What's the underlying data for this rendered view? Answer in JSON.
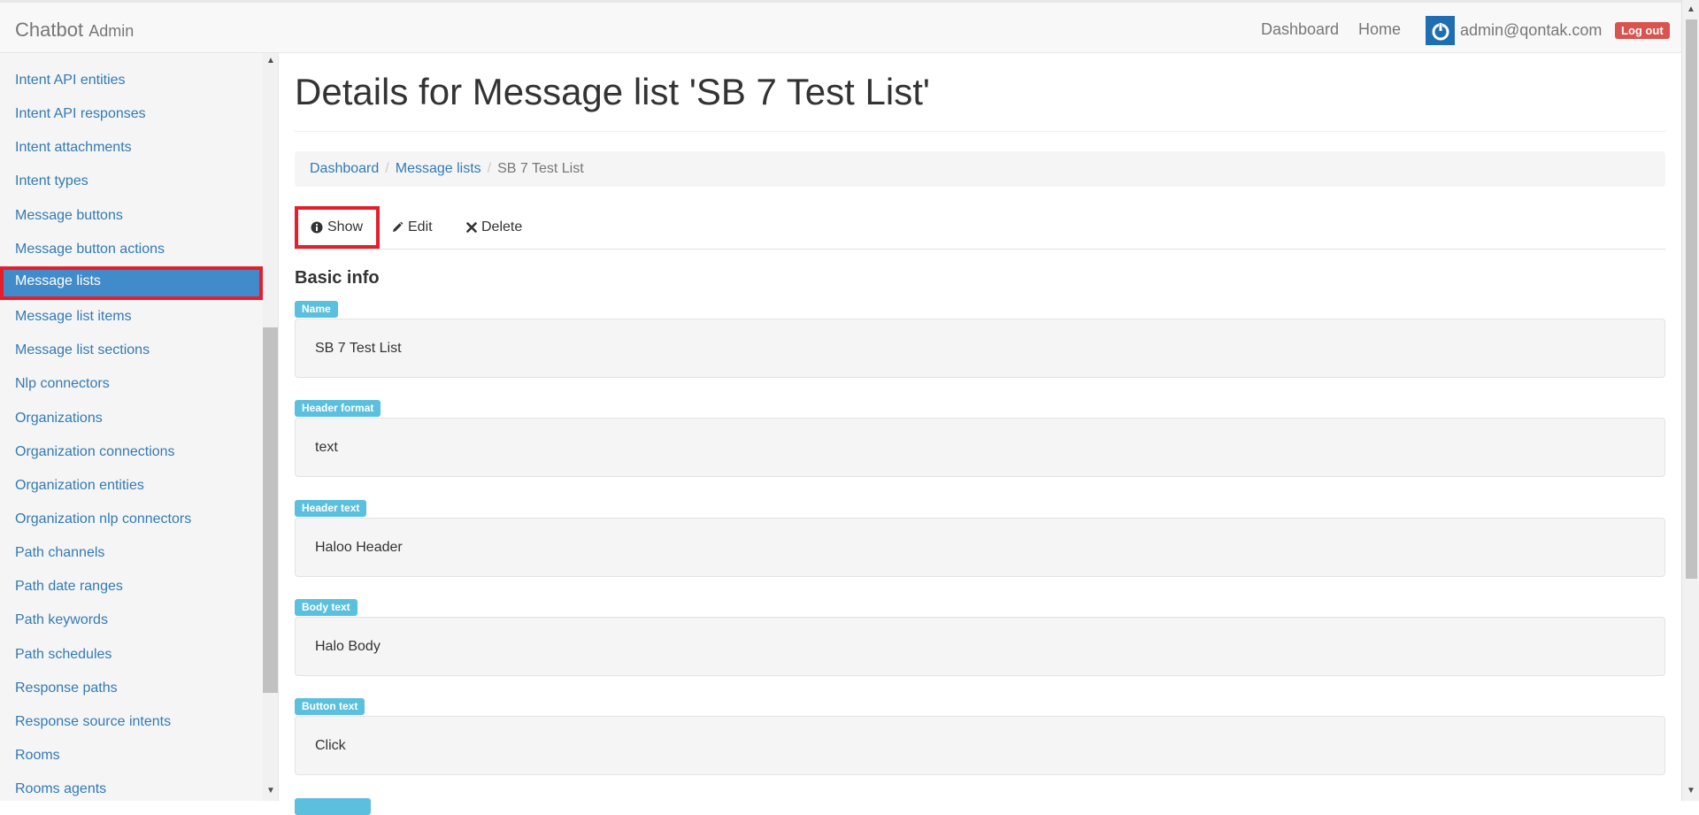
{
  "topbar": {
    "brand": "Chatbot",
    "brand_sub": "Admin",
    "nav": {
      "dashboard": "Dashboard",
      "home": "Home"
    },
    "user_email": "admin@qontak.com",
    "logout_label": "Log out"
  },
  "sidebar": {
    "items": [
      {
        "label": "Intent API entities"
      },
      {
        "label": "Intent API responses"
      },
      {
        "label": "Intent attachments"
      },
      {
        "label": "Intent types"
      },
      {
        "label": "Message buttons"
      },
      {
        "label": "Message button actions"
      },
      {
        "label": "Message lists",
        "active": true
      },
      {
        "label": "Message list items"
      },
      {
        "label": "Message list sections"
      },
      {
        "label": "Nlp connectors"
      },
      {
        "label": "Organizations"
      },
      {
        "label": "Organization connections"
      },
      {
        "label": "Organization entities"
      },
      {
        "label": "Organization nlp connectors"
      },
      {
        "label": "Path channels"
      },
      {
        "label": "Path date ranges"
      },
      {
        "label": "Path keywords"
      },
      {
        "label": "Path schedules"
      },
      {
        "label": "Response paths"
      },
      {
        "label": "Response source intents"
      },
      {
        "label": "Rooms"
      },
      {
        "label": "Rooms agents"
      }
    ]
  },
  "main": {
    "title": "Details for Message list 'SB 7 Test List'",
    "breadcrumb": {
      "dashboard": "Dashboard",
      "message_lists": "Message lists",
      "current": "SB 7 Test List",
      "separator": "/"
    },
    "tabs": {
      "show": "Show",
      "edit": "Edit",
      "delete": "Delete"
    },
    "section_title": "Basic info",
    "fields": [
      {
        "label": "Name",
        "value": "SB 7 Test List"
      },
      {
        "label": "Header format",
        "value": "text"
      },
      {
        "label": "Header text",
        "value": "Haloo Header"
      },
      {
        "label": "Body text",
        "value": "Halo Body"
      },
      {
        "label": "Button text",
        "value": "Click"
      }
    ]
  },
  "colors": {
    "link": "#337ab7",
    "active_bg": "#428bca",
    "highlight_border": "#e41e2c",
    "label_bg": "#5bc0de",
    "logout_bg": "#d9534f"
  }
}
